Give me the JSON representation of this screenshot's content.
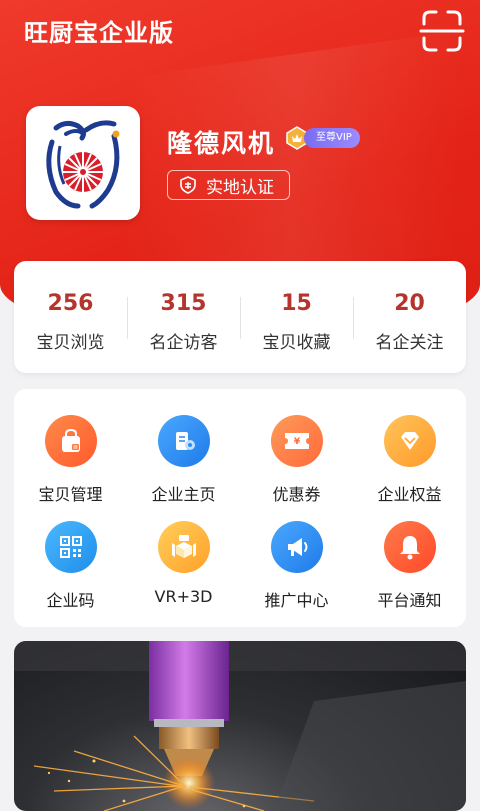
{
  "app": {
    "title": "旺厨宝企业版"
  },
  "company": {
    "name": "隆德风机",
    "vip_label": "至尊VIP",
    "certification": "实地认证"
  },
  "stats": [
    {
      "value": "256",
      "label": "宝贝浏览"
    },
    {
      "value": "315",
      "label": "名企访客"
    },
    {
      "value": "15",
      "label": "宝贝收藏"
    },
    {
      "value": "20",
      "label": "名企关注"
    }
  ],
  "menu": [
    {
      "label": "宝贝管理",
      "icon": "shopping-bag-icon",
      "color": "#ff6a3d"
    },
    {
      "label": "企业主页",
      "icon": "company-homepage-icon",
      "color": "#2e8ff0"
    },
    {
      "label": "优惠券",
      "icon": "coupon-icon",
      "color": "#ff7a3d"
    },
    {
      "label": "企业权益",
      "icon": "diamond-icon",
      "color": "#ffa93a"
    },
    {
      "label": "企业码",
      "icon": "qr-code-icon",
      "color": "#2aa0f0"
    },
    {
      "label": "VR+3D",
      "icon": "vr-3d-cube-icon",
      "color": "#ffb23a"
    },
    {
      "label": "推广中心",
      "icon": "megaphone-icon",
      "color": "#2e8ff0"
    },
    {
      "label": "平台通知",
      "icon": "bell-icon",
      "color": "#ff5a36"
    }
  ],
  "colors": {
    "brand_red": "#e42317",
    "stat_number": "#b5352d",
    "page_background": "#f2f2f4"
  }
}
